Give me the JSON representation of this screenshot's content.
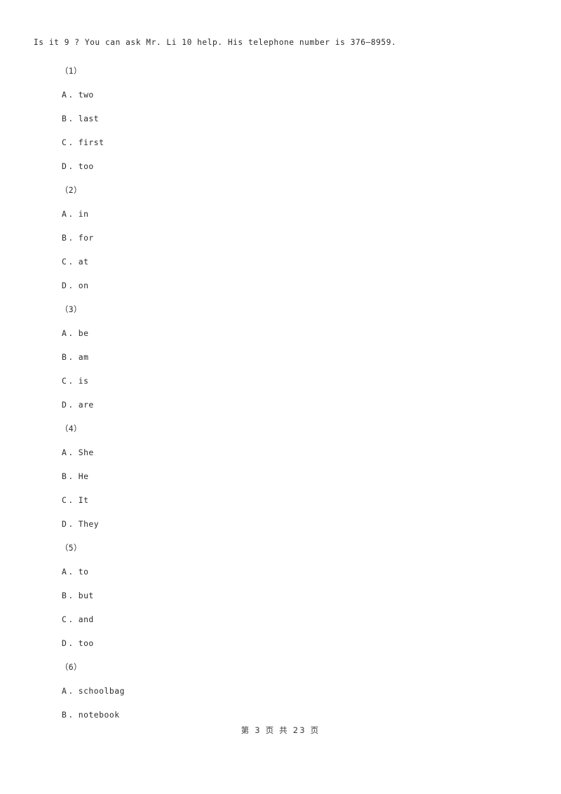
{
  "document": {
    "passage": "Is it 9 ? You can ask Mr. Li 10 help. His telephone number is 376—8959.",
    "questions": [
      {
        "number": "（1）",
        "options": [
          {
            "letter": "A",
            "separator": ".",
            "text": "two"
          },
          {
            "letter": "B",
            "separator": ".",
            "text": "last"
          },
          {
            "letter": "C",
            "separator": ".",
            "text": "first"
          },
          {
            "letter": "D",
            "separator": ".",
            "text": "too"
          }
        ]
      },
      {
        "number": "（2）",
        "options": [
          {
            "letter": "A",
            "separator": ".",
            "text": "in"
          },
          {
            "letter": "B",
            "separator": ".",
            "text": "for"
          },
          {
            "letter": "C",
            "separator": ".",
            "text": "at"
          },
          {
            "letter": "D",
            "separator": ".",
            "text": "on"
          }
        ]
      },
      {
        "number": "（3）",
        "options": [
          {
            "letter": "A",
            "separator": ".",
            "text": "be"
          },
          {
            "letter": "B",
            "separator": ".",
            "text": "am"
          },
          {
            "letter": "C",
            "separator": ".",
            "text": "is"
          },
          {
            "letter": "D",
            "separator": ".",
            "text": "are"
          }
        ]
      },
      {
        "number": "（4）",
        "options": [
          {
            "letter": "A",
            "separator": ".",
            "text": "She"
          },
          {
            "letter": "B",
            "separator": ".",
            "text": "He"
          },
          {
            "letter": "C",
            "separator": ".",
            "text": "It"
          },
          {
            "letter": "D",
            "separator": ".",
            "text": "They"
          }
        ]
      },
      {
        "number": "（5）",
        "options": [
          {
            "letter": "A",
            "separator": ".",
            "text": "to"
          },
          {
            "letter": "B",
            "separator": ".",
            "text": "but"
          },
          {
            "letter": "C",
            "separator": ".",
            "text": "and"
          },
          {
            "letter": "D",
            "separator": ".",
            "text": "too"
          }
        ]
      },
      {
        "number": "（6）",
        "options": [
          {
            "letter": "A",
            "separator": ".",
            "text": "schoolbag"
          },
          {
            "letter": "B",
            "separator": ".",
            "text": "notebook"
          }
        ]
      }
    ]
  },
  "footer": {
    "page_indicator": "第 3 页 共 23 页"
  }
}
